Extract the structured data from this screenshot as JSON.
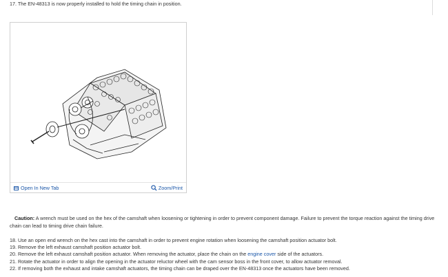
{
  "step17": "17. The EN-48313 is now properly installed to hold the timing chain in position.",
  "figure": {
    "open_new_tab": "Open In New Tab",
    "zoom_print": "Zoom/Print",
    "image_icon": "engine-line-drawing"
  },
  "caution": {
    "label": "Caution:",
    "text": "A wrench must be used on the hex of the camshaft when loosening or tightening in order to prevent component damage. Failure to prevent the torque reaction against the timing drive chain can lead to timing drive chain failure."
  },
  "steps": {
    "s18": "18. Use an open end wrench on the hex cast into the camshaft in order to prevent engine rotation when loosening the camshaft position actuator bolt.",
    "s19": "19. Remove the left exhaust camshaft position actuator bolt.",
    "s20_before": "20. Remove the left exhaust camshaft position actuator. When removing the actuator, place the chain on the ",
    "s20_link": "engine cover",
    "s20_after": " side of the actuators.",
    "s21": "21. Rotate the actuator in order to align the opening in the actuator reluctor wheel with the cam sensor boss in the front cover, to allow actuator removal.",
    "s22": "22. If removing both the exhaust and intake camshaft actuators, the timing chain can be draped over the EN-48313 once the actuators have been removed."
  },
  "colors": {
    "link": "#1a56a8",
    "text": "#333333",
    "border": "#cfcfcf"
  }
}
